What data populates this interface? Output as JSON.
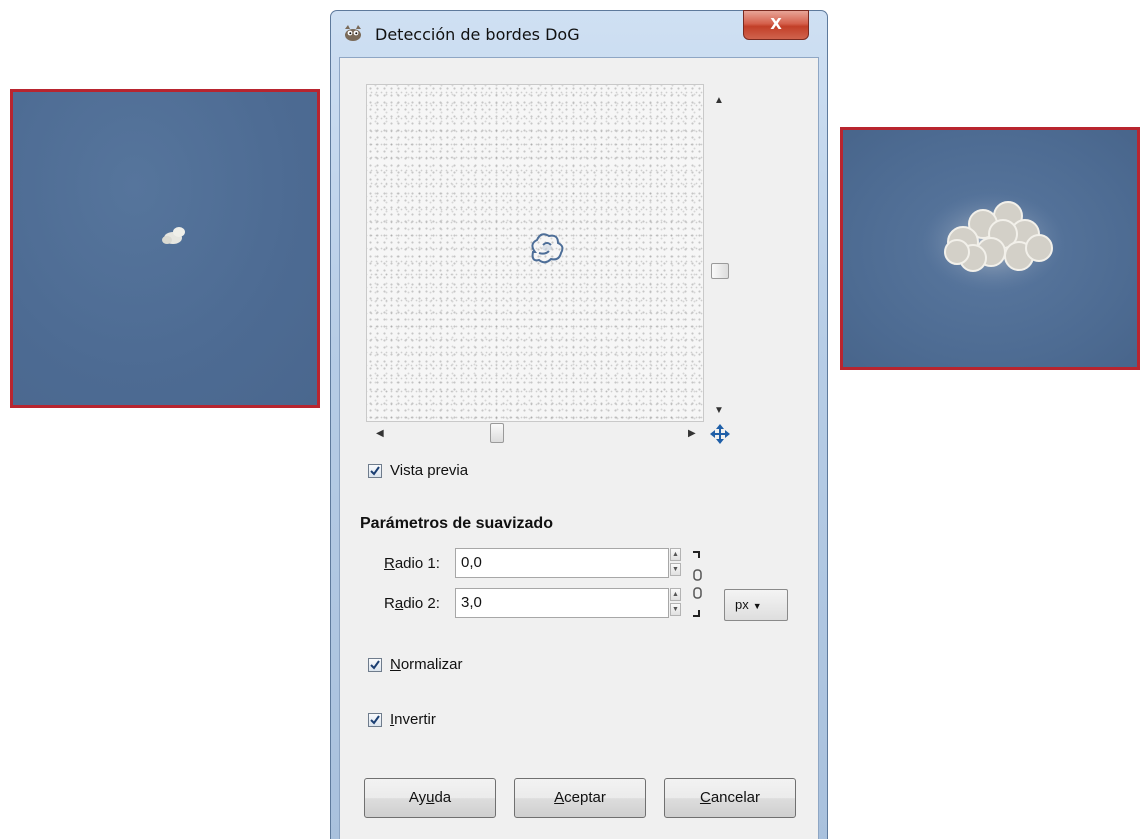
{
  "window": {
    "title": "Detección de bordes DoG",
    "close_label": "X"
  },
  "preview": {
    "checkbox_label": "Vista previa",
    "checked": true
  },
  "smoothing": {
    "section_title": "Parámetros de suavizado",
    "radius1": {
      "label_mnemonic": "R",
      "label_rest": "adio 1:",
      "value": "0,0"
    },
    "radius2": {
      "label_mnemonic": "a",
      "label_pre": "R",
      "label_rest": "dio 2:",
      "value": "3,0"
    },
    "unit": "px"
  },
  "options": {
    "normalize": {
      "mnemonic": "N",
      "rest": "ormalizar",
      "checked": true
    },
    "invert": {
      "mnemonic": "I",
      "rest": "nvertir",
      "checked": true
    }
  },
  "buttons": {
    "help": {
      "pre": "Ay",
      "mnemonic": "u",
      "rest": "da"
    },
    "ok": {
      "mnemonic": "A",
      "rest": "ceptar"
    },
    "cancel": {
      "mnemonic": "C",
      "rest": "ancelar"
    }
  },
  "colors": {
    "photo_border": "#b8252f",
    "photo_background": "#4f6f97",
    "title_close": "#c23f28"
  }
}
